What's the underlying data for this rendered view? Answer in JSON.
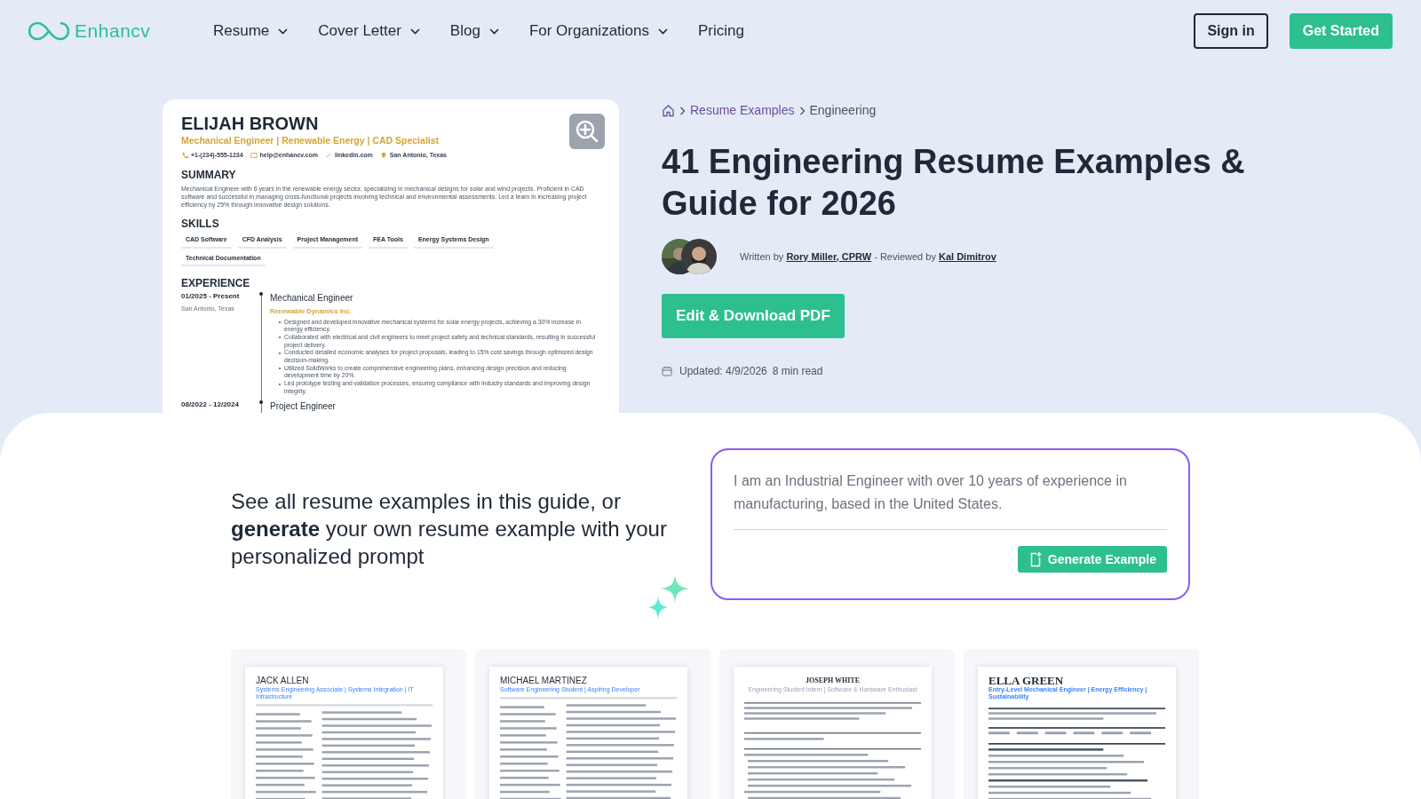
{
  "header": {
    "logo": "Enhancv",
    "nav": [
      {
        "label": "Resume",
        "has_menu": true
      },
      {
        "label": "Cover Letter",
        "has_menu": true
      },
      {
        "label": "Blog",
        "has_menu": true
      },
      {
        "label": "For Organizations",
        "has_menu": true
      },
      {
        "label": "Pricing",
        "has_menu": false
      }
    ],
    "sign_in": "Sign in",
    "get_started": "Get Started"
  },
  "preview": {
    "name": "ELIJAH BROWN",
    "headline": "Mechanical Engineer | Renewable Energy | CAD Specialist",
    "contacts": [
      {
        "kind": "phone",
        "text": "+1-(234)-555-1234"
      },
      {
        "kind": "email",
        "text": "help@enhancv.com"
      },
      {
        "kind": "link",
        "text": "linkedin.com"
      },
      {
        "kind": "location",
        "text": "San Antonio, Texas"
      }
    ],
    "summary_heading": "SUMMARY",
    "summary": "Mechanical Engineer with 6 years in the renewable energy sector, specializing in mechanical designs for solar and wind projects. Proficient in CAD software and successful in managing cross-functional projects involving technical and environmental assessments. Led a team in increasing project efficiency by 25% through innovative design solutions.",
    "skills_heading": "SKILLS",
    "skills": [
      "CAD Software",
      "CFD Analysis",
      "Project Management",
      "FEA Tools",
      "Energy Systems Design",
      "Technical Documentation"
    ],
    "experience_heading": "EXPERIENCE",
    "jobs": [
      {
        "dates": "01/2025 - Present",
        "location": "San Antonio, Texas",
        "title": "Mechanical Engineer",
        "company": "Renewable Dynamics Inc.",
        "bullets": [
          "Designed and developed innovative mechanical systems for solar energy projects, achieving a 30% increase in energy efficiency.",
          "Collaborated with electrical and civil engineers to meet project safety and technical standards, resulting in successful project delivery.",
          "Conducted detailed economic analyses for project proposals, leading to 15% cost savings through optimized design decision-making.",
          "Utilized SolidWorks to create comprehensive engineering plans, enhancing design precision and reducing development time by 20%.",
          "Led prototype testing and validation processes, ensuring compliance with industry standards and improving design integrity."
        ]
      },
      {
        "dates": "08/2022 - 12/2024",
        "title": "Project Engineer"
      }
    ]
  },
  "breadcrumb": [
    {
      "label": "Resume Examples",
      "current": false
    },
    {
      "label": "Engineering",
      "current": true
    }
  ],
  "title": "41 Engineering Resume Examples & Guide for 2026",
  "byline": {
    "written_label": "Written by",
    "author": "Rory Miller, CPRW",
    "reviewed_label": "- Reviewed by",
    "reviewer": "Kal Dimitrov"
  },
  "cta": "Edit & Download PDF",
  "updated": "Updated: 4/9/2026",
  "read_time": "8 min read",
  "generator": {
    "intro": "See all resume examples in this guide, or **generate** your own resume example with your personalized prompt",
    "placeholder": "I am an Industrial Engineer with over 10 years of experience in manufacturing, based in the United States.",
    "button": "Generate Example"
  },
  "examples": [
    {
      "kind": "two-column",
      "name": "JACK ALLEN",
      "headline": "Systems Engineering Associate | Systems Integration | IT Infrastructure"
    },
    {
      "kind": "two-column",
      "name": "MICHAEL MARTINEZ",
      "headline": "Software Engineering Student | Aspiring Developer"
    },
    {
      "kind": "centered",
      "name": "JOSEPH WHITE",
      "headline": "Engineering Student Intern | Software & Hardware Enthusiast"
    },
    {
      "kind": "bold",
      "name": "ELLA GREEN",
      "headline": "Entry-Level Mechanical Engineer | Energy Efficiency | Sustainability"
    }
  ]
}
